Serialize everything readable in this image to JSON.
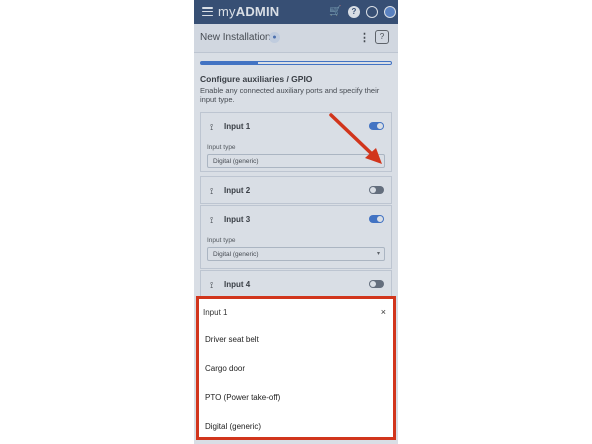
{
  "app": {
    "brand_prefix": "my",
    "brand_suffix": "ADMIN",
    "icons": [
      "menu-icon",
      "cart-icon",
      "help-icon",
      "globe-icon",
      "user-icon"
    ],
    "topbar_color": "#1f3a63"
  },
  "header": {
    "title": "New Installation",
    "badge_icon": "person-icon",
    "more_icon": "⋮",
    "help_icon": "?"
  },
  "progress": {
    "value": 0.3,
    "color": "#2f6bd0"
  },
  "section": {
    "title": "Configure auxiliaries / GPIO",
    "description": "Enable any connected auxiliary ports and specify their input type."
  },
  "inputs": [
    {
      "label": "Input 1",
      "enabled": true,
      "type_label": "Input type",
      "type_value": "Digital (generic)"
    },
    {
      "label": "Input 2",
      "enabled": false
    },
    {
      "label": "Input 3",
      "enabled": true,
      "type_label": "Input type",
      "type_value": "Digital (generic)"
    },
    {
      "label": "Input 4",
      "enabled": false
    }
  ],
  "sheet": {
    "title": "Input 1",
    "close_icon": "×",
    "options": [
      "Driver seat belt",
      "Cargo door",
      "PTO (Power take-off)",
      "Digital (generic)"
    ],
    "highlight_color": "#d1351c"
  },
  "annotation": {
    "arrow_color": "#d1351c"
  }
}
